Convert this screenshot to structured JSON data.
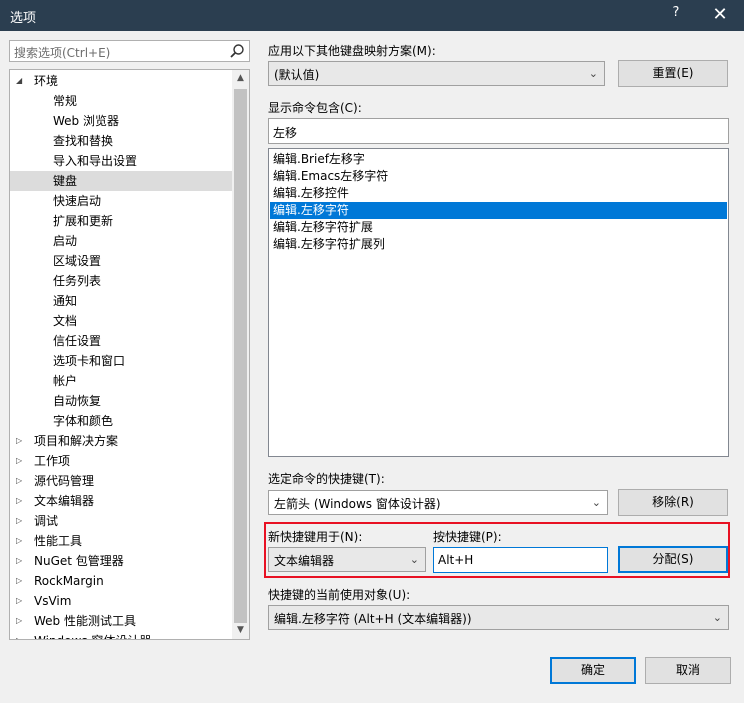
{
  "window": {
    "title": "选项",
    "help_label": "?",
    "close_label": "✕"
  },
  "search": {
    "placeholder": "搜索选项(Ctrl+E)",
    "icon": "search-icon"
  },
  "tree": {
    "items": [
      {
        "label": "环境",
        "level": 0,
        "expand": "expanded"
      },
      {
        "label": "常规",
        "level": 1
      },
      {
        "label": "Web 浏览器",
        "level": 1
      },
      {
        "label": "查找和替换",
        "level": 1
      },
      {
        "label": "导入和导出设置",
        "level": 1
      },
      {
        "label": "键盘",
        "level": 1,
        "selected": true
      },
      {
        "label": "快速启动",
        "level": 1
      },
      {
        "label": "扩展和更新",
        "level": 1
      },
      {
        "label": "启动",
        "level": 1
      },
      {
        "label": "区域设置",
        "level": 1
      },
      {
        "label": "任务列表",
        "level": 1
      },
      {
        "label": "通知",
        "level": 1
      },
      {
        "label": "文档",
        "level": 1
      },
      {
        "label": "信任设置",
        "level": 1
      },
      {
        "label": "选项卡和窗口",
        "level": 1
      },
      {
        "label": "帐户",
        "level": 1
      },
      {
        "label": "自动恢复",
        "level": 1
      },
      {
        "label": "字体和颜色",
        "level": 1
      },
      {
        "label": "项目和解决方案",
        "level": 0,
        "expand": "collapsed"
      },
      {
        "label": "工作项",
        "level": 0,
        "expand": "collapsed"
      },
      {
        "label": "源代码管理",
        "level": 0,
        "expand": "collapsed"
      },
      {
        "label": "文本编辑器",
        "level": 0,
        "expand": "collapsed"
      },
      {
        "label": "调试",
        "level": 0,
        "expand": "collapsed"
      },
      {
        "label": "性能工具",
        "level": 0,
        "expand": "collapsed"
      },
      {
        "label": "NuGet 包管理器",
        "level": 0,
        "expand": "collapsed"
      },
      {
        "label": "RockMargin",
        "level": 0,
        "expand": "collapsed"
      },
      {
        "label": "VsVim",
        "level": 0,
        "expand": "collapsed"
      },
      {
        "label": "Web 性能测试工具",
        "level": 0,
        "expand": "collapsed"
      },
      {
        "label": "Windows 窗体设计器",
        "level": 0,
        "expand": "collapsed"
      }
    ]
  },
  "mapping": {
    "label": "应用以下其他键盘映射方案(M):",
    "value": "(默认值)",
    "reset_label": "重置(E)"
  },
  "commands": {
    "label": "显示命令包含(C):",
    "filter_value": "左移",
    "items": [
      {
        "label": "编辑.Brief左移字"
      },
      {
        "label": "编辑.Emacs左移字符"
      },
      {
        "label": "编辑.左移控件"
      },
      {
        "label": "编辑.左移字符",
        "selected": true
      },
      {
        "label": "编辑.左移字符扩展"
      },
      {
        "label": "编辑.左移字符扩展列"
      }
    ]
  },
  "shortcuts": {
    "label": "选定命令的快捷键(T):",
    "value": "左箭头 (Windows 窗体设计器)",
    "remove_label": "移除(R)"
  },
  "new_shortcut": {
    "scope_label": "新快捷键用于(N):",
    "scope_value": "文本编辑器",
    "press_label": "按快捷键(P):",
    "press_value": "Alt+H",
    "assign_label": "分配(S)"
  },
  "used_by": {
    "label": "快捷键的当前使用对象(U):",
    "value": "编辑.左移字符 (Alt+H (文本编辑器))"
  },
  "footer": {
    "ok_label": "确定",
    "cancel_label": "取消"
  },
  "colors": {
    "titlebar": "#2b3e50",
    "selection": "#0078d7",
    "highlight_box": "#e81123"
  }
}
